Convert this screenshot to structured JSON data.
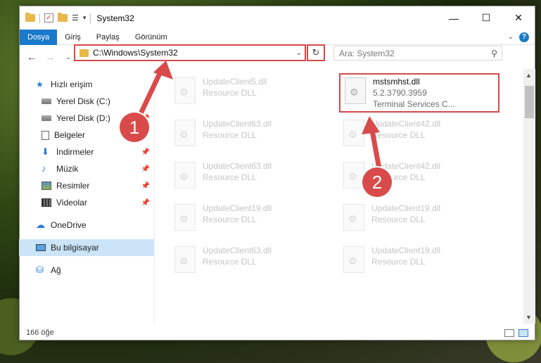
{
  "window": {
    "title": "System32"
  },
  "ribbon": {
    "tabs": [
      "Dosya",
      "Giriş",
      "Paylaş",
      "Görünüm"
    ]
  },
  "address": {
    "path": "C:\\Windows\\System32"
  },
  "search": {
    "placeholder": "Ara: System32"
  },
  "sidebar": {
    "quick_access": "Hızlı erişim",
    "items": [
      {
        "label": "Yerel Disk (C:)",
        "icon": "disk-icon"
      },
      {
        "label": "Yerel Disk (D:)",
        "icon": "disk-icon"
      },
      {
        "label": "Belgeler",
        "icon": "documents-icon"
      },
      {
        "label": "İndirmeler",
        "icon": "download-icon"
      },
      {
        "label": "Müzik",
        "icon": "music-icon"
      },
      {
        "label": "Resimler",
        "icon": "pictures-icon"
      },
      {
        "label": "Videolar",
        "icon": "video-icon"
      }
    ],
    "onedrive": "OneDrive",
    "this_pc": "Bu bilgisayar",
    "network": "Ağ"
  },
  "files": [
    {
      "name": "UpdateClient5.dll",
      "type": "Resource DLL"
    },
    {
      "name": "mstsmhst.dll",
      "version": "5.2.3790.3959",
      "desc": "Terminal Services C..."
    },
    {
      "name": "UpdateClient63.dll",
      "type": "Resource DLL"
    },
    {
      "name": "UpdateClient42.dll",
      "type": "Resource DLL"
    },
    {
      "name": "UpdateClient63.dll",
      "type": "Resource DLL"
    },
    {
      "name": "UpdateClient42.dll",
      "type": "Resource DLL"
    },
    {
      "name": "UpdateClient19.dll",
      "type": "Resource DLL"
    },
    {
      "name": "UpdateClient19.dll",
      "type": "Resource DLL"
    },
    {
      "name": "UpdateClient63.dll",
      "type": "Resource DLL"
    },
    {
      "name": "UpdateClient19.dll",
      "type": "Resource DLL"
    }
  ],
  "status": {
    "count": "166 öğe"
  },
  "annotations": {
    "step1": "1",
    "step2": "2",
    "color": "#d94b4b"
  }
}
